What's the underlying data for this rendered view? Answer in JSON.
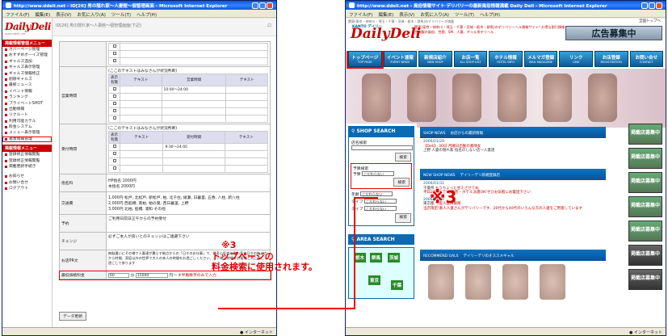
{
  "left_window": {
    "title": "http://www.ddeli.net - ID[26] 男の隠れ家〜人妻館〜個管理画面 - Microsoft Internet Explorer",
    "menu": [
      "ファイル(F)",
      "編集(E)",
      "表示(V)",
      "お気に入り(A)",
      "ツール(T)",
      "ヘルプ(H)"
    ],
    "logo": "DailyDeli",
    "logo_sub": "www.ddeli.net",
    "top_text": "ID[26]  男の隠れ家〜人妻館〜個管理画面(下記)",
    "top_right": "ロ",
    "section1": "掲載情報管理メニュー",
    "nav1": [
      "カバーページ管理",
      "おすすめボーイズ管理",
      "ギャルズ追加",
      "ギャルズ表示管理",
      "ギャルズ情報修正",
      "削除ギャルズ",
      "最新ニュース",
      "イベント情報",
      "ランキング",
      "プライベートSHOT",
      "出勤情報",
      "リクルート",
      "利用可能カテル",
      "料金システム",
      "メニュー表示管理",
      "基本情報管理"
    ],
    "section2": "掲載情報メニュー",
    "nav2": [
      "登録修正情報閲覧",
      "登録修正情報閲覧",
      "掲載更新手続き"
    ],
    "nav3": [
      "お知らせ",
      "お問い合せ",
      "ログアウト"
    ],
    "form": {
      "eigyo_note": "(ここのテキストはみなさんが状況判断)",
      "eigyo_label": "営業時間",
      "col_display": "表示\n有無",
      "col_text": "テキスト",
      "col_hours": "営業時間",
      "eigyo_value": "10:00〜24:00",
      "uketsuke_note": "(ここのテキストはみなさんが状況判断)",
      "uketsuke_label": "受付時間",
      "col_uketsuke": "受付時間",
      "uketsuke_value": "9:30〜24:00",
      "shimei_label": "指名料",
      "shimei_value": "HP指名  1000円\n本指名  2000円",
      "kotsu_label": "交通費",
      "kotsu_value": "1,000円 松戸, 北松戸, 新松戸, 柏, 北千住, 綾瀬, 日暮里, 五香, 八柱, 新八柱\n2,000円 西船橋, 南柏, 柏の葉, 西日暮里, 上野\n3,000円 北柏, 船橋, 浦和 その他",
      "yoyaku_label": "予約",
      "yoyaku_value": "ご利用日前日正午からの予約受付",
      "change_label": "チェンジ",
      "change_value": "必ずご本人が良いとのチェンジはご遠慮下さい",
      "pr_label": "お店PR文",
      "pr_value": "無駄遣いにその様で人妻達が暮らす拠点からの「日々のお仕事」で、好奇心旺盛と思い直す日々の忙しさから時間、家庭以外の世界で大人の本人の時間をお過ごしください、ご一緒に時間をお客様と共に楽しく過ごして参ります",
      "saitei_label": "最低価格料金",
      "saitei_min": "60",
      "saitei_unit1": "分",
      "saitei_price": "15000",
      "saitei_unit2": "円〜",
      "saitei_note": "※半角数字のみで入力",
      "submit": "データ更新"
    },
    "status": "インターネット"
  },
  "annotation": {
    "mark": "※3",
    "line1": "トップページの",
    "line2": "料金検索に使用されます。",
    "big_mark": "※3"
  },
  "right_window": {
    "title": "http://www.ddeli.net - 風俗情報サイト デリバリーの最新風俗情報満載 Daily Deli - Microsoft Internet Explorer",
    "menu": [
      "ファイル(F)",
      "編集(E)",
      "表示(V)",
      "お気に入り(A)",
      "ツール(T)",
      "ヘルプ(H)"
    ],
    "top_small": "関東(東京・神奈川・埼玉・千葉・茨城・栃木・群馬)のデリバリーが満載",
    "kanto": "KANTO デイリー",
    "logo": "DailyDeli",
    "pr_text": "関東(東京・神奈川・埼玉・千葉・茨城・栃木・群馬)のデリバリーヘル情報サイト! お得な割引情報が満載の風俗、性感、SM、人妻、ギャル系デリヘル",
    "all_top": "全国トップへ",
    "ad": "広告募集中",
    "nav": [
      {
        "label": "トップページ",
        "sub": "TOP PAGE"
      },
      {
        "label": "イベント速報",
        "sub": "EVENT NEWS"
      },
      {
        "label": "新規店紹介",
        "sub": "NEW SHOP"
      },
      {
        "label": "お店一覧",
        "sub": "ALL SHOP LIST"
      },
      {
        "label": "ホテル情報",
        "sub": "HOTEL INFO"
      },
      {
        "label": "メルマガ登録",
        "sub": "MAIL MAGAZINE"
      },
      {
        "label": "リンク",
        "sub": "LINK"
      },
      {
        "label": "お店登録",
        "sub": "REGISTRATION"
      },
      {
        "label": "お問い合せ",
        "sub": "CONTACT"
      }
    ],
    "shop_search": "SHOP SEARCH",
    "shop_name_label": "店名検索",
    "search_btn": "検索",
    "budget_label": "予算検索",
    "budget_select_label": "予算",
    "budget_select": "こだわらない",
    "age_label": "年齢",
    "age_select": "こだわらない",
    "type_label": "タイプ",
    "type_select": "こだわらない",
    "shop_news": "SHOP NEWS",
    "shop_news_sub": "お店からの最新情報",
    "news1_date": "2006/01/29",
    "news1_text": "【Deli】 30日 月曜日出勤の素晴女",
    "news1_shop": "上野  人妻の隠れ家",
    "news1_extra": "指名のしない店〜人妻達",
    "new_shop_news": "NEW SHOP NEWS",
    "new_shop_sub": "デイリーデリ新規登録店",
    "ns1_date": "2006/01/31",
    "ns1_shop": "千葉県",
    "ns1_name": "もうちょっと甘えさせてね",
    "ns1_text": "平日24時まで!ご自宅・ホテル派遣OK!ぜひお気軽にお電話下さい",
    "ns2_date": "2006/01/30",
    "ns2_shop": "東京都",
    "ns2_name": "今度人妻探検隊",
    "ns2_text": "当店限定!素人人妻さんがデリバリーです、20代から40代のいろんな方の人妻をご用意しています",
    "recommend": "RECOMMEND GALS",
    "recommend_sub": "デイリーデリのオススメギャル",
    "area_search": "AREA SEARCH",
    "areas": [
      "栃木",
      "茨城",
      "群馬",
      "東京",
      "千葉"
    ],
    "side_ad": "掲載店募集中",
    "status": "インターネット"
  }
}
